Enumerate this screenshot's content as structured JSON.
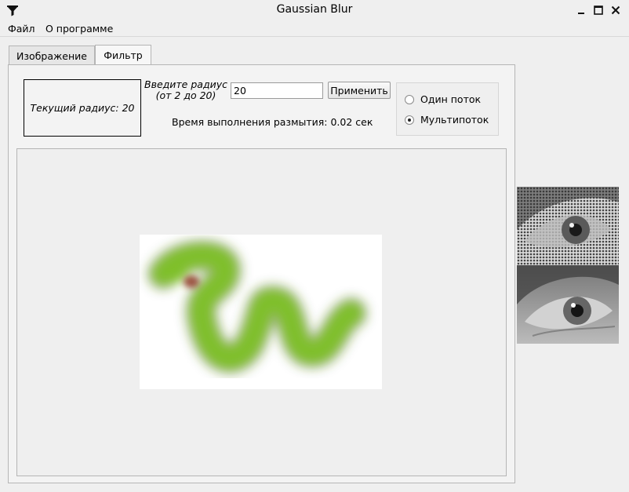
{
  "window": {
    "title": "Gaussian Blur",
    "icon": "funnel-icon",
    "controls": [
      "minimize-icon",
      "maximize-icon",
      "close-icon"
    ]
  },
  "menu": {
    "file": "Файл",
    "about": "О программе"
  },
  "tabs": [
    {
      "label": "Изображение",
      "active": false
    },
    {
      "label": "Фильтр",
      "active": true
    }
  ],
  "filter": {
    "current_radius": "Текущий радиус: 20",
    "prompt_line1": "Введите радиус",
    "prompt_line2": "(от 2 до 20)",
    "radius_value": "20",
    "apply_label": "Применить",
    "time_text": "Время выполнения размытия: 0.02 сек",
    "modes": [
      {
        "label": "Один поток",
        "checked": false
      },
      {
        "label": "Мультипоток",
        "checked": true
      }
    ]
  },
  "colors": {
    "snake_green": "#7fbf2a",
    "snake_eye": "#8a2f1a",
    "window_bg": "#efefef"
  }
}
